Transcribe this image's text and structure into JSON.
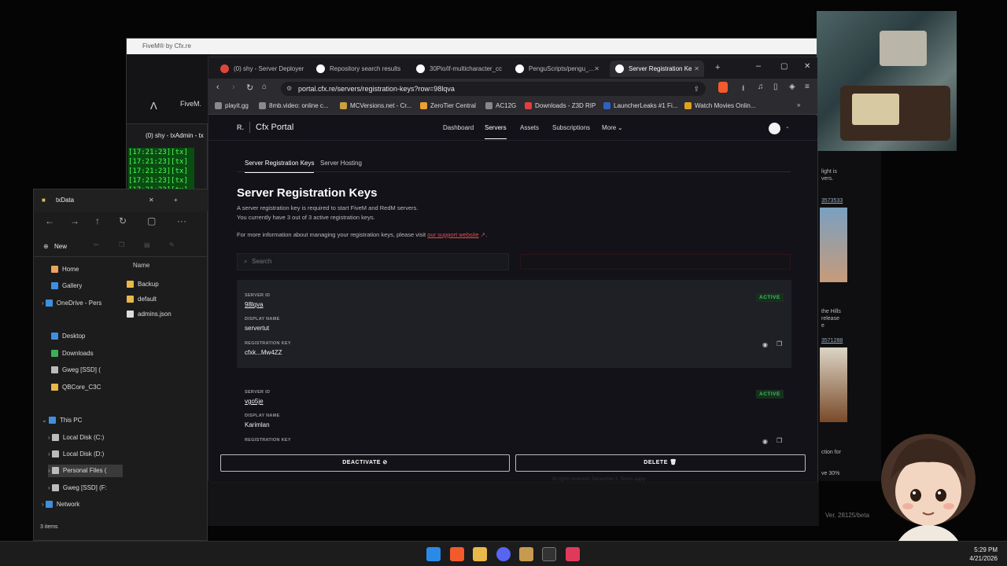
{
  "fivem_window": {
    "title": "FiveM® by Cfx.re",
    "logo_text": "FiveM."
  },
  "txadmin_window": {
    "title": "(0) shy - txAdmin - tx",
    "terminal_lines": [
      "[17:21:23][tx]",
      "[17:21:23][tx]",
      "[17:21:23][tx]",
      "[17:21:23][tx]",
      "[17:21:23][tx]"
    ]
  },
  "right_window": {
    "text1": "light is\nvers.",
    "link1": "3573533",
    "text2": "the Hills\nrelease\ne",
    "link2": "3571288",
    "text3": "ction for",
    "text4": "ve 30%",
    "version": "Ver. 28125/beta"
  },
  "explorer": {
    "title": "txData",
    "new_label": "New",
    "column_name": "Name",
    "tree": [
      {
        "label": "Home",
        "color": "#e8a45c"
      },
      {
        "label": "Gallery",
        "color": "#3f8fe0"
      },
      {
        "label": "OneDrive - Pers",
        "color": "#3f8fe0"
      },
      {
        "label": "Desktop",
        "color": "#3f8fe0"
      },
      {
        "label": "Downloads",
        "color": "#3fae5a"
      },
      {
        "label": "Gweg [SSD] (",
        "color": "#bbbbbb"
      },
      {
        "label": "QBCore_C3C",
        "color": "#e8b84a"
      },
      {
        "label": "This PC",
        "color": "#3f8fe0"
      },
      {
        "label": "Local Disk (C:)",
        "color": "#bbbbbb"
      },
      {
        "label": "Local Disk (D:)",
        "color": "#bbbbbb"
      },
      {
        "label": "Personal Files (",
        "color": "#bbbbbb"
      },
      {
        "label": "Gweg [SSD] (F:",
        "color": "#bbbbbb"
      },
      {
        "label": "Network",
        "color": "#3f8fe0"
      }
    ],
    "files": [
      {
        "name": "Backup",
        "type": "folder"
      },
      {
        "name": "default",
        "type": "folder"
      },
      {
        "name": "admins.json",
        "type": "file"
      }
    ],
    "status": "3 items"
  },
  "browser": {
    "tabs": [
      {
        "label": "(0) shy - Server Deployer",
        "fav": "#e0453a"
      },
      {
        "label": "Repository search results",
        "fav": "#ffffff"
      },
      {
        "label": "30Pio/if-multicharacter_cc",
        "fav": "#ffffff"
      },
      {
        "label": "PenguScripts/pengu_...",
        "fav": "#ffffff"
      },
      {
        "label": "Server Registration Ke",
        "fav": "#ffffff"
      }
    ],
    "url": "portal.cfx.re/servers/registration-keys?row=98lqva",
    "bookmarks": [
      {
        "label": "playit.gg",
        "color": "#8a8a8a"
      },
      {
        "label": "8mb.video: online c...",
        "color": "#8a8a8a"
      },
      {
        "label": "MCVersions.net - Cr...",
        "color": "#c8a040"
      },
      {
        "label": "ZeroTier Central",
        "color": "#f0a030"
      },
      {
        "label": "AC12G",
        "color": "#888888"
      },
      {
        "label": "Downloads - Z3D RIP",
        "color": "#e04040"
      },
      {
        "label": "LauncherLeaks #1 Fi...",
        "color": "#3060c0"
      },
      {
        "label": "Watch Movies Onlin...",
        "color": "#e0a020"
      }
    ]
  },
  "portal": {
    "brand": "Cfx Portal",
    "nav": [
      "Dashboard",
      "Servers",
      "Assets",
      "Subscriptions",
      "More"
    ],
    "subtabs": [
      "Server Registration Keys",
      "Server Hosting"
    ],
    "heading": "Server Registration Keys",
    "desc1": "A server registration key is required to start FiveM and RedM servers.",
    "desc2": "You currently have 3 out of 3 active registration keys.",
    "desc3": "For more information about managing your registration keys, please visit",
    "desc3_link": "our support website",
    "search_placeholder": "Search",
    "labels": {
      "server_id": "SERVER ID",
      "display_name": "DISPLAY NAME",
      "registration_key": "REGISTRATION KEY"
    },
    "keys": [
      {
        "server_id": "98lqva",
        "display_name": "servertut",
        "registration_key": "cfxk...Mw4ZZ",
        "status": "ACTIVE"
      },
      {
        "server_id": "vgo5je",
        "display_name": "Karimlan",
        "registration_key": "",
        "status": "ACTIVE"
      }
    ],
    "deactivate_label": "DEACTIVATE",
    "delete_label": "DELETE",
    "footer_faint": "All rights reserved. December 1. Terms apply"
  },
  "clock": {
    "time": "5:29 PM",
    "date": "4/21/2026"
  }
}
